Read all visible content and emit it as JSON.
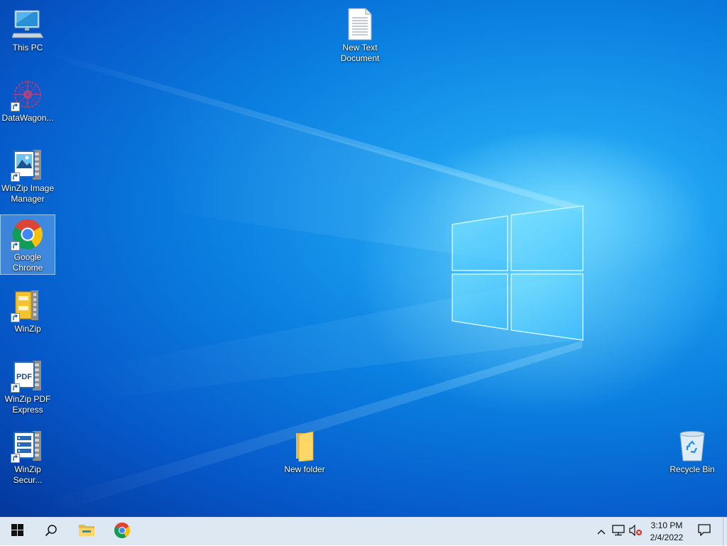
{
  "desktop": {
    "icons": [
      {
        "label": "This PC",
        "icon": "computer-icon"
      },
      {
        "label": "DataWagon...",
        "icon": "datawagon-icon"
      },
      {
        "label": "WinZip Image Manager",
        "icon": "winzip-image-manager-icon"
      },
      {
        "label": "Google Chrome",
        "icon": "chrome-icon"
      },
      {
        "label": "WinZip",
        "icon": "winzip-icon"
      },
      {
        "label": "WinZip PDF Express",
        "icon": "winzip-pdf-icon"
      },
      {
        "label": "WinZip Secur...",
        "icon": "winzip-secure-icon"
      },
      {
        "label": "New Text Document",
        "icon": "text-document-icon"
      },
      {
        "label": "New folder",
        "icon": "folder-icon"
      },
      {
        "label": "Recycle Bin",
        "icon": "recycle-bin-icon"
      }
    ],
    "selected_icon": "Google Chrome"
  },
  "taskbar": {
    "pinned": [
      {
        "name": "start",
        "icon": "windows-logo-icon"
      },
      {
        "name": "search",
        "icon": "search-icon"
      },
      {
        "name": "file-explorer",
        "icon": "folder-icon"
      },
      {
        "name": "chrome",
        "icon": "chrome-icon"
      }
    ],
    "tray": {
      "icons": [
        "chevron-up-icon",
        "network-icon",
        "volume-muted-icon"
      ],
      "time": "3:10 PM",
      "date": "2/4/2022"
    },
    "notification_icon": "notification-icon"
  },
  "colors": {
    "taskbar_bg": "#dde8f2",
    "desktop_accent": "#0a7fe0"
  }
}
